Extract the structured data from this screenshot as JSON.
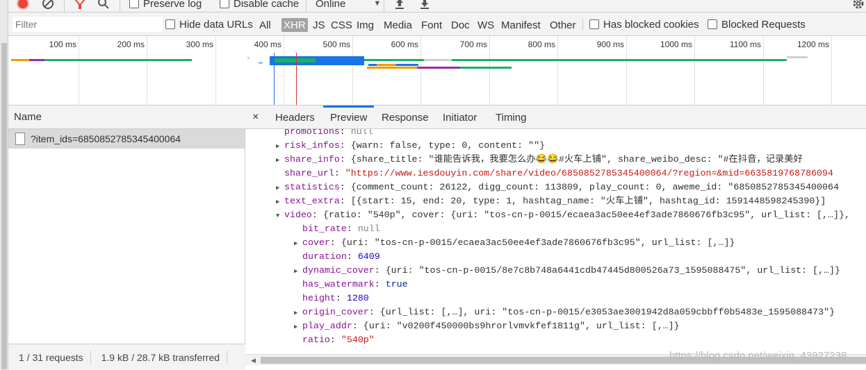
{
  "toolbar": {
    "preserve_log": "Preserve log",
    "disable_cache": "Disable cache",
    "throttling": "Online"
  },
  "filterbar": {
    "filter_placeholder": "Filter",
    "hide_data_urls": "Hide data URLs",
    "types": [
      "All",
      "XHR",
      "JS",
      "CSS",
      "Img",
      "Media",
      "Font",
      "Doc",
      "WS",
      "Manifest",
      "Other"
    ],
    "active_type": "XHR",
    "has_blocked_cookies": "Has blocked cookies",
    "blocked_requests": "Blocked Requests"
  },
  "overview": {
    "ticks": [
      "100 ms",
      "200 ms",
      "300 ms",
      "400 ms",
      "500 ms",
      "600 ms",
      "700 ms",
      "800 ms",
      "900 ms",
      "1000 ms",
      "1100 ms",
      "1200 ms"
    ]
  },
  "requests": {
    "header": "Name",
    "rows": [
      "?item_ids=6850852785345400064"
    ],
    "status_count": "1 / 31 requests",
    "status_size": "1.9 kB / 28.7 kB transferred"
  },
  "detail": {
    "close": "×",
    "tabs": [
      "Headers",
      "Preview",
      "Response",
      "Initiator",
      "Timing"
    ],
    "active_tab": "Preview",
    "lines": [
      {
        "key": "promotions",
        "rest": "null"
      },
      {
        "key": "risk_infos",
        "rest": "{warn: false, type: 0, content: \"\"}"
      },
      {
        "key": "share_info",
        "rest": "{share_title: \"谁能告诉我，我要怎么办😂😂#火车上铺\", share_weibo_desc: \"#在抖音，记录美好"
      },
      {
        "key": "share_url",
        "rest": "\"https://www.iesdouyin.com/share/video/6850852785345400064/?region=&mid=6635819768786094"
      },
      {
        "key": "statistics",
        "rest": "{comment_count: 26122, digg_count: 113809, play_count: 0, aweme_id: \"6850852785345400064"
      },
      {
        "key": "text_extra",
        "rest": "[{start: 15, end: 20, type: 1, hashtag_name: \"火车上铺\", hashtag_id: 1591448598245390}]"
      },
      {
        "key": "video",
        "rest": "{ratio: \"540p\", cover: {uri: \"tos-cn-p-0015/ecaea3ac50ee4ef3ade7860676fb3c95\", url_list: [,…]},"
      },
      {
        "key": "bit_rate",
        "rest": "null"
      },
      {
        "key": "cover",
        "rest": "{uri: \"tos-cn-p-0015/ecaea3ac50ee4ef3ade7860676fb3c95\", url_list: [,…]}"
      },
      {
        "key": "duration",
        "rest": "6409"
      },
      {
        "key": "dynamic_cover",
        "rest": "{uri: \"tos-cn-p-0015/8e7c8b748a6441cdb47445d800526a73_1595088475\", url_list: [,…]}"
      },
      {
        "key": "has_watermark",
        "rest": "true"
      },
      {
        "key": "height",
        "rest": "1280"
      },
      {
        "key": "origin_cover",
        "rest": "{url_list: [,…], uri: \"tos-cn-p-0015/e3053ae3001942d8a059cbbff0b5483e_1595088473\"}"
      },
      {
        "key": "play_addr",
        "rest": "{uri: \"v0200f450000bs9hrorlvmvkfef1811g\", url_list: [,…]}"
      },
      {
        "key": "ratio",
        "rest": "\"540p\""
      }
    ]
  },
  "watermark": "https://blog.csdn.net/weixin_43927238",
  "colors": {
    "accent": "#1a73e8",
    "record": "#e8453c",
    "waterfall_green": "#18b45a",
    "waterfall_blue": "#1a73e8",
    "waterfall_orange": "#f29900",
    "waterfall_purple": "#9c27b0"
  }
}
